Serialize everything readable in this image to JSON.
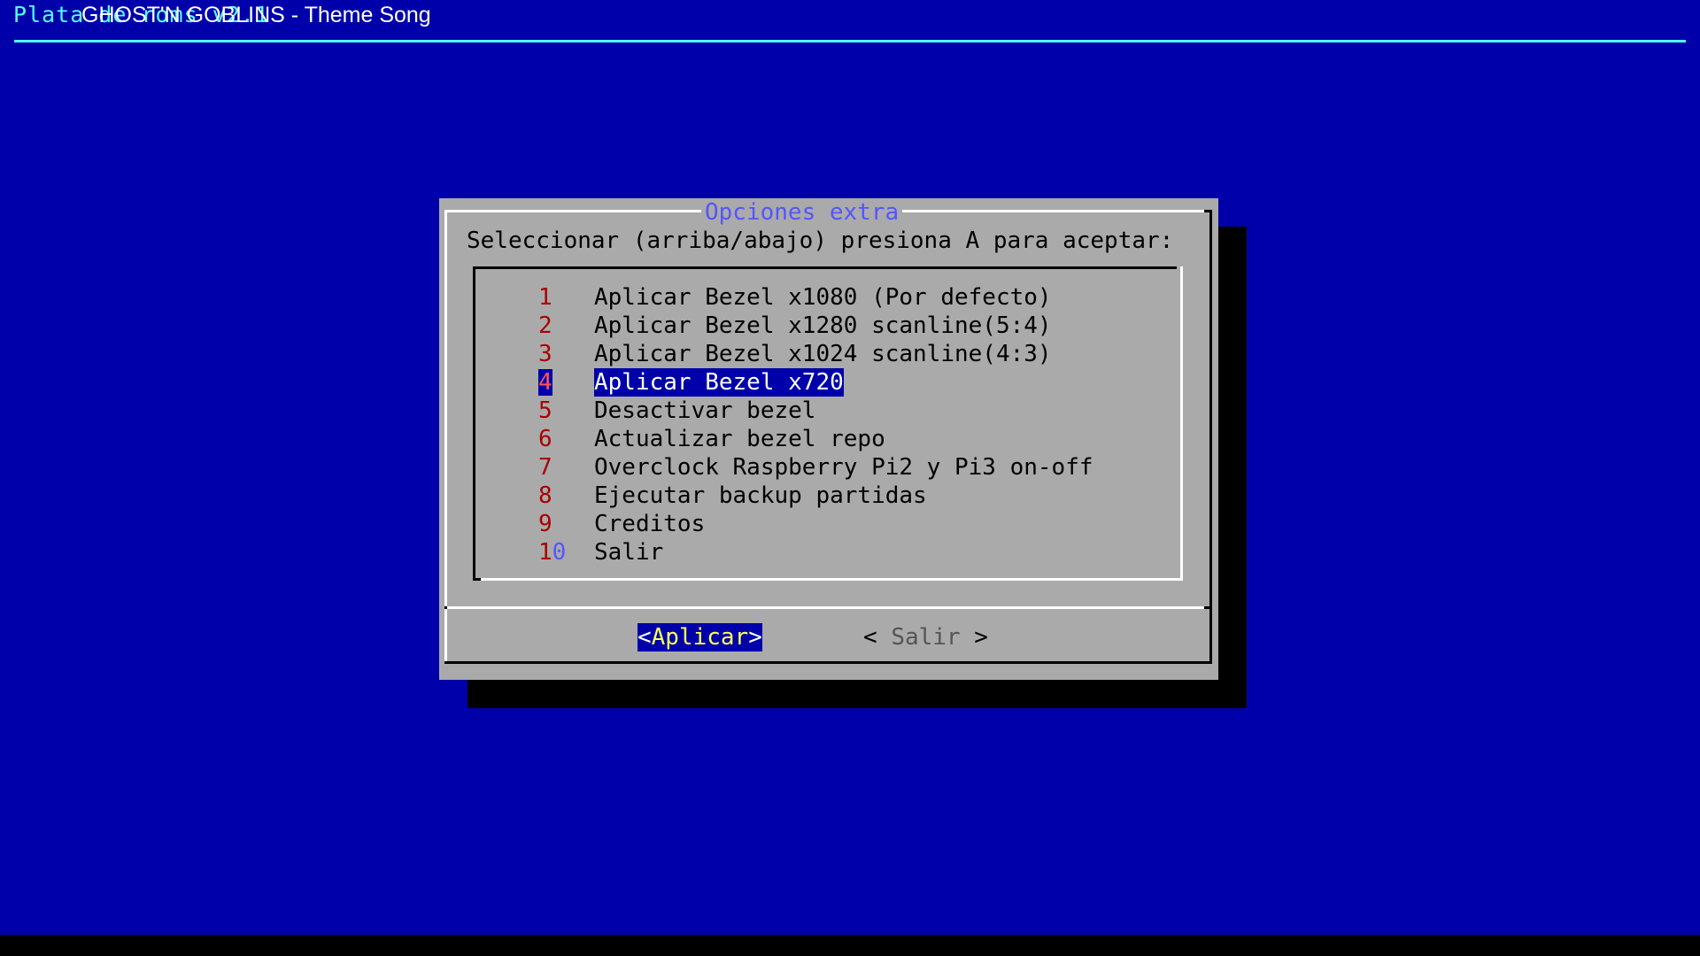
{
  "backtitle": "Plata de roms v2.1",
  "song_overlay": "GHOST'N GOBLINS - Theme Song",
  "dialog": {
    "title": "Opciones extra",
    "prompt": "Seleccionar (arriba/abajo) presiona A para aceptar:",
    "selected_index": 3,
    "items": [
      {
        "num": "1",
        "label": "Aplicar Bezel x1080 (Por defecto)"
      },
      {
        "num": "2",
        "label": "Aplicar Bezel x1280 scanline(5:4)"
      },
      {
        "num": "3",
        "label": "Aplicar Bezel x1024 scanline(4:3)"
      },
      {
        "num": "4",
        "label": "Aplicar Bezel x720"
      },
      {
        "num": "5",
        "label": "Desactivar bezel"
      },
      {
        "num": "6",
        "label": "Actualizar bezel repo"
      },
      {
        "num": "7",
        "label": "Overclock Raspberry Pi2 y Pi3 on-off"
      },
      {
        "num": "8",
        "label": "Ejecutar backup partidas"
      },
      {
        "num": "9",
        "label": "Creditos"
      },
      {
        "num": "10",
        "label": "Salir"
      }
    ],
    "buttons": {
      "apply": {
        "open": "<",
        "text": "Aplicar",
        "close": ">"
      },
      "exit": {
        "open": "< ",
        "text": "Salir",
        "close": " >"
      }
    }
  },
  "colors": {
    "background": "#0000aa",
    "dialog": "#aaaaaa",
    "title": "#5555ff",
    "hotkey": "#aa0000",
    "highlight": "#0000aa",
    "apply_text": "#ffff55"
  }
}
